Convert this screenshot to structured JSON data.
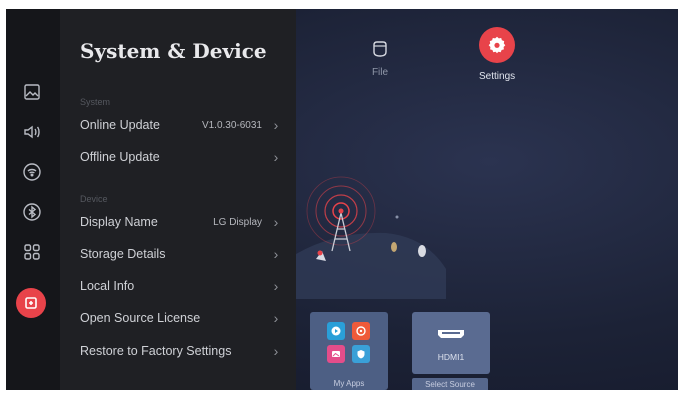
{
  "panel": {
    "title": "System & Device",
    "system_section": "System",
    "device_section": "Device",
    "items": [
      {
        "label": "Online Update",
        "value": "V1.0.30-6031"
      },
      {
        "label": "Offline Update",
        "value": ""
      },
      {
        "label": "Display Name",
        "value": "LG Display"
      },
      {
        "label": "Storage Details",
        "value": ""
      },
      {
        "label": "Local Info",
        "value": ""
      },
      {
        "label": "Open Source License",
        "value": ""
      },
      {
        "label": "Restore to Factory Settings",
        "value": ""
      }
    ]
  },
  "sidebar": {
    "icons": [
      "image-icon",
      "speaker-icon",
      "wifi-icon",
      "bluetooth-icon",
      "apps-grid-icon",
      "system-device-icon"
    ],
    "active": "system-device-icon"
  },
  "top_menu": {
    "file_label": "File",
    "settings_label": "Settings"
  },
  "tiles": {
    "my_apps_label": "My Apps",
    "hdmi_label": "HDMI1",
    "select_source_label": "Select Source"
  },
  "colors": {
    "accent": "#e8434a",
    "panel": "#1f2024",
    "rail": "#15161a",
    "tile": "#4d5f84"
  }
}
